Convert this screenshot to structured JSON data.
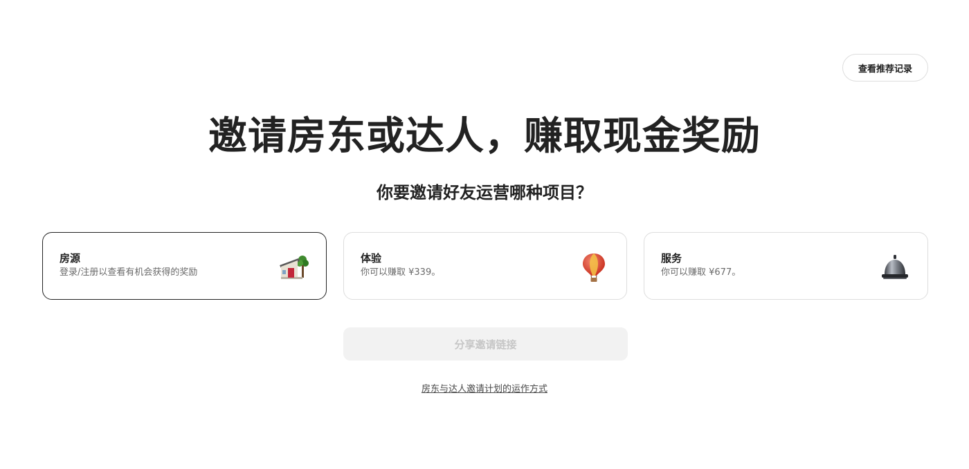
{
  "header": {
    "history_button_label": "查看推荐记录"
  },
  "hero": {
    "title": "邀请房东或达人，赚取现金奖励",
    "question": "你要邀请好友运营哪种项目？"
  },
  "options": [
    {
      "title": "房源",
      "description": "登录/注册以查看有机会获得的奖励",
      "icon": "house-icon",
      "selected": true
    },
    {
      "title": "体验",
      "description": "你可以赚取 ¥339。",
      "icon": "hot-air-balloon-icon",
      "selected": false
    },
    {
      "title": "服务",
      "description": "你可以赚取 ¥677。",
      "icon": "service-bell-icon",
      "selected": false
    }
  ],
  "actions": {
    "share_button_label": "分享邀请链接",
    "share_button_disabled": true,
    "how_it_works_link": "房东与达人邀请计划的运作方式"
  },
  "colors": {
    "text_primary": "#222222",
    "text_secondary": "#6a6a6a",
    "border": "#dddddd",
    "disabled_bg": "#f2f2f2",
    "disabled_text": "#c6c6c6"
  }
}
